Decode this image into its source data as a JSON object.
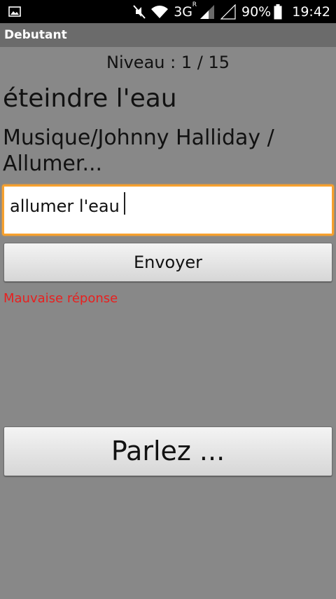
{
  "status_bar": {
    "network": "3G",
    "network_sup": "R",
    "battery_percent": "90%",
    "time": "19:42",
    "icons": [
      "image-notification-icon",
      "mute-icon",
      "wifi-icon",
      "signal-icon",
      "signal-empty-icon",
      "battery-icon"
    ]
  },
  "app": {
    "title": "Debutant"
  },
  "game": {
    "level_text": "Niveau : 1 / 15",
    "question": "éteindre l'eau",
    "hint": "Musique/Johnny Halliday / Allumer..."
  },
  "answer": {
    "value": "allumer l'eau",
    "placeholder": ""
  },
  "buttons": {
    "send_label": "Envoyer",
    "speak_label": "Parlez ..."
  },
  "feedback": {
    "message": "Mauvaise réponse"
  },
  "colors": {
    "background": "#888888",
    "focus_border": "#f7a12e",
    "error": "#e8201f"
  }
}
